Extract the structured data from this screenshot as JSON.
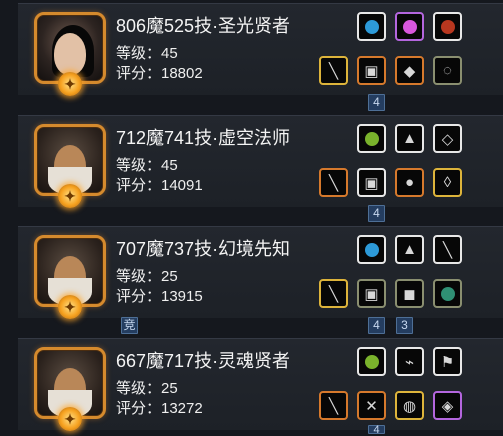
{
  "players": [
    {
      "name": "806魔525技·圣光贤者",
      "level": "等级：45",
      "score": "评分：18802",
      "portrait": "female-avatar-icon",
      "equipment_top": [
        "blue-orb-icon",
        "pink-gem-icon",
        "red-amulet-icon"
      ],
      "equipment_bottom": [
        "staff-icon",
        "armor-icon",
        "relic-icon",
        "ring-icon"
      ],
      "tag_top": "4"
    },
    {
      "name": "712魔741技·虚空法师",
      "level": "等级：45",
      "score": "评分：14091",
      "portrait": "bearded-elder-avatar-icon",
      "equipment_top": [
        "green-crystal-icon",
        "boots-icon",
        "necklace-icon"
      ],
      "equipment_bottom": [
        "staff-icon",
        "armor-icon",
        "orb-icon",
        "pendant-icon"
      ],
      "tag_top": "4"
    },
    {
      "name": "707魔737技·幻境先知",
      "level": "等级：25",
      "score": "评分：13915",
      "portrait": "bearded-elder-avatar-icon",
      "equipment_top": [
        "blue-orb-icon",
        "boots-icon",
        "wand-icon"
      ],
      "equipment_bottom": [
        "golden-staff-icon",
        "armor-icon",
        "mask-icon",
        "green-gem-icon"
      ],
      "tag_top": "4",
      "tag_bottom": [
        "竞",
        "4",
        "3"
      ]
    },
    {
      "name": "667魔717技·灵魂贤者",
      "level": "等级：25",
      "score": "评分：13272",
      "portrait": "bearded-elder-avatar-icon",
      "equipment_top": [
        "green-crystal-icon",
        "wing-icon",
        "flag-icon"
      ],
      "equipment_bottom": [
        "staff-icon",
        "spider-icon",
        "cloak-icon",
        "rune-icon"
      ],
      "tag_bottom": [
        "4"
      ]
    }
  ],
  "colors": {
    "background": "#15181e",
    "row": "#23272e",
    "gold_border": "#d58a2d",
    "tag": "#243d60"
  }
}
